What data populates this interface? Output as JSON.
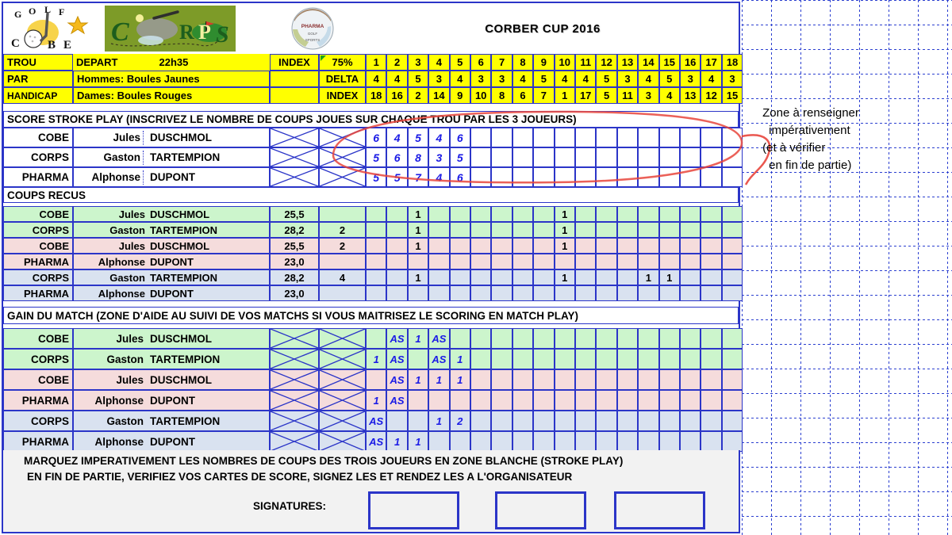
{
  "header": {
    "title": "CORBER CUP 2016",
    "logos": [
      {
        "name": "golf-cobe-logo",
        "text_top": "GOLF",
        "text_bottom": "COBE"
      },
      {
        "name": "corps-logo",
        "text": "CORPS"
      },
      {
        "name": "pharma-logo",
        "line1": "PHARMA",
        "line2": "GOLF",
        "line3": "SPORTS"
      }
    ]
  },
  "info_rows": {
    "labels": [
      "TROU",
      "PAR",
      "HANDICAP"
    ],
    "depart_label": "DEPART",
    "depart_time": "22h35",
    "hommes": "Hommes: Boules Jaunes",
    "dames": "Dames: Boules Rouges",
    "index_label": "INDEX",
    "pct": "75%",
    "delta_label": "DELTA",
    "index_label2": "INDEX"
  },
  "holes": [
    1,
    2,
    3,
    4,
    5,
    6,
    7,
    8,
    9,
    10,
    11,
    12,
    13,
    14,
    15,
    16,
    17,
    18
  ],
  "par": [
    4,
    4,
    5,
    3,
    4,
    3,
    3,
    4,
    5,
    4,
    4,
    5,
    3,
    4,
    5,
    3,
    4,
    3
  ],
  "handicap": [
    18,
    16,
    2,
    14,
    9,
    10,
    8,
    6,
    7,
    1,
    17,
    5,
    11,
    3,
    4,
    13,
    12,
    15
  ],
  "stroke_play": {
    "header": "SCORE STROKE PLAY (INSCRIVEZ LE NOMBRE DE COUPS JOUES SUR CHAQUE TROU PAR LES 3 JOUEURS)",
    "players": [
      {
        "club": "COBE",
        "first": "Jules",
        "last": "DUSCHMOL",
        "scores": [
          6,
          4,
          5,
          4,
          6
        ]
      },
      {
        "club": "CORPS",
        "first": "Gaston",
        "last": "TARTEMPION",
        "scores": [
          5,
          6,
          8,
          3,
          5
        ]
      },
      {
        "club": "PHARMA",
        "first": "Alphonse",
        "last": "DUPONT",
        "scores": [
          5,
          5,
          7,
          4,
          6
        ]
      }
    ]
  },
  "coups_recus": {
    "header": "COUPS RECUS",
    "rows": [
      {
        "club": "COBE",
        "first": "Jules",
        "last": "DUSCHMOL",
        "index": "25,5",
        "delta": "",
        "marks": {
          "3": "1",
          "10": "1"
        },
        "color": "green"
      },
      {
        "club": "CORPS",
        "first": "Gaston",
        "last": "TARTEMPION",
        "index": "28,2",
        "delta": "2",
        "marks": {
          "3": "1",
          "10": "1"
        },
        "color": "green"
      },
      {
        "club": "COBE",
        "first": "Jules",
        "last": "DUSCHMOL",
        "index": "25,5",
        "delta": "2",
        "marks": {
          "3": "1",
          "10": "1"
        },
        "color": "pink"
      },
      {
        "club": "PHARMA",
        "first": "Alphonse",
        "last": "DUPONT",
        "index": "23,0",
        "delta": "",
        "marks": {},
        "color": "pink"
      },
      {
        "club": "CORPS",
        "first": "Gaston",
        "last": "TARTEMPION",
        "index": "28,2",
        "delta": "4",
        "marks": {
          "3": "1",
          "10": "1",
          "14": "1",
          "15": "1"
        },
        "color": "blue"
      },
      {
        "club": "PHARMA",
        "first": "Alphonse",
        "last": "DUPONT",
        "index": "23,0",
        "delta": "",
        "marks": {},
        "color": "blue"
      }
    ]
  },
  "gain_du_match": {
    "header": "GAIN DU MATCH (ZONE D'AIDE AU SUIVI DE VOS MATCHS SI VOUS MAITRISEZ LE SCORING EN MATCH PLAY)",
    "rows": [
      {
        "club": "COBE",
        "first": "Jules",
        "last": "DUSCHMOL",
        "marks": {
          "2": "AS",
          "3": "1",
          "4": "AS"
        },
        "color": "green"
      },
      {
        "club": "CORPS",
        "first": "Gaston",
        "last": "TARTEMPION",
        "marks": {
          "1": "1",
          "2": "AS",
          "4": "AS",
          "5": "1"
        },
        "color": "green"
      },
      {
        "club": "COBE",
        "first": "Jules",
        "last": "DUSCHMOL",
        "marks": {
          "2": "AS",
          "3": "1",
          "4": "1",
          "5": "1"
        },
        "color": "pink"
      },
      {
        "club": "PHARMA",
        "first": "Alphonse",
        "last": "DUPONT",
        "marks": {
          "1": "1",
          "2": "AS"
        },
        "color": "pink"
      },
      {
        "club": "CORPS",
        "first": "Gaston",
        "last": "TARTEMPION",
        "marks": {
          "1": "AS",
          "4": "1",
          "5": "2"
        },
        "color": "blue"
      },
      {
        "club": "PHARMA",
        "first": "Alphonse",
        "last": "DUPONT",
        "marks": {
          "1": "AS",
          "2": "1",
          "3": "1"
        },
        "color": "blue"
      }
    ]
  },
  "footer": {
    "line1": "MARQUEZ IMPERATIVEMENT LES NOMBRES DE COUPS DES TROIS JOUEURS EN ZONE BLANCHE (STROKE PLAY)",
    "line2": "EN FIN DE PARTIE, VERIFIEZ VOS CARTES DE SCORE, SIGNEZ LES ET RENDEZ LES A L'ORGANISATEUR",
    "signatures_label": "SIGNATURES:"
  },
  "annotation": {
    "line1": "Zone à renseigner",
    "line2": "impérativement",
    "line3": "(et à vérifier",
    "line4": "en fin de partie)",
    "color": "#e8453c"
  }
}
